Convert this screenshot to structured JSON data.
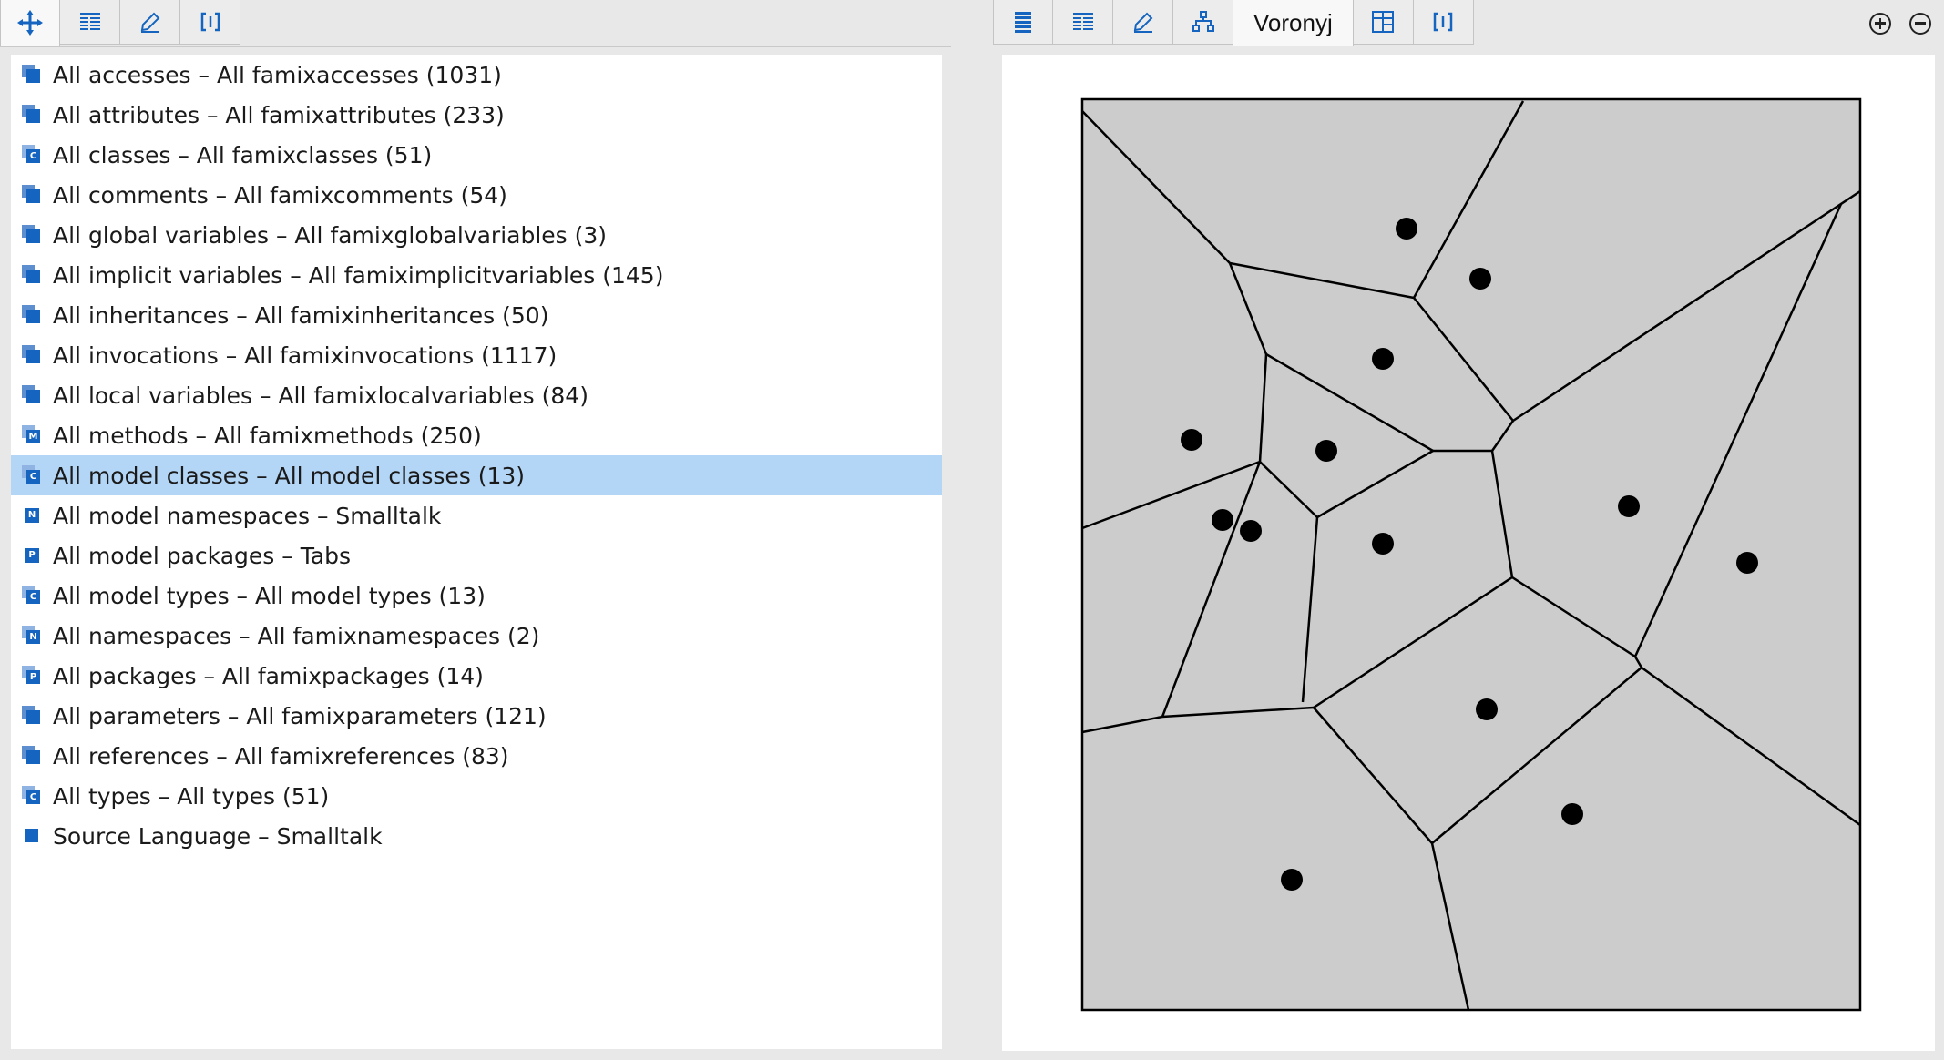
{
  "left_tabs": [
    {
      "icon": "move-icon",
      "selected": true
    },
    {
      "icon": "list-icon",
      "selected": false
    },
    {
      "icon": "pencil-icon",
      "selected": false
    },
    {
      "icon": "brackets-icon",
      "selected": false
    }
  ],
  "right_tabs": [
    {
      "icon": "list-icon"
    },
    {
      "icon": "table-icon"
    },
    {
      "icon": "pencil-icon"
    },
    {
      "icon": "tree-icon"
    },
    {
      "label": "Voronyj",
      "selected": true
    },
    {
      "icon": "grid-icon"
    },
    {
      "icon": "brackets-icon"
    }
  ],
  "list": [
    {
      "label": "All accesses – All famixaccesses (1031)",
      "icon": "stack"
    },
    {
      "label": "All attributes – All famixattributes (233)",
      "icon": "stack"
    },
    {
      "label": "All classes – All famixclasses (51)",
      "icon": "stack",
      "letter": "C"
    },
    {
      "label": "All comments – All famixcomments (54)",
      "icon": "stack"
    },
    {
      "label": "All global variables – All famixglobalvariables (3)",
      "icon": "stack"
    },
    {
      "label": "All implicit variables – All famiximplicitvariables (145)",
      "icon": "stack"
    },
    {
      "label": "All inheritances – All famixinheritances (50)",
      "icon": "stack"
    },
    {
      "label": "All invocations – All famixinvocations (1117)",
      "icon": "stack"
    },
    {
      "label": "All local variables – All famixlocalvariables (84)",
      "icon": "stack"
    },
    {
      "label": "All methods – All famixmethods (250)",
      "icon": "stack",
      "letter": "M"
    },
    {
      "label": "All model classes – All model classes (13)",
      "icon": "stack",
      "letter": "C",
      "selected": true
    },
    {
      "label": "All model namespaces – Smalltalk",
      "icon": "single",
      "letter": "N"
    },
    {
      "label": "All model packages – Tabs",
      "icon": "single",
      "letter": "P"
    },
    {
      "label": "All model types – All model types (13)",
      "icon": "stack",
      "letter": "C"
    },
    {
      "label": "All namespaces – All famixnamespaces (2)",
      "icon": "stack",
      "letter": "N"
    },
    {
      "label": "All packages – All famixpackages (14)",
      "icon": "stack",
      "letter": "P"
    },
    {
      "label": "All parameters – All famixparameters (121)",
      "icon": "stack"
    },
    {
      "label": "All references – All famixreferences (83)",
      "icon": "stack"
    },
    {
      "label": "All types – All types (51)",
      "icon": "stack",
      "letter": "C"
    },
    {
      "label": "Source Language – Smalltalk",
      "icon": "square"
    }
  ],
  "colors": {
    "accent": "#1565c0",
    "selection": "#b3d6f7",
    "cell_fill": "#cccccc"
  }
}
